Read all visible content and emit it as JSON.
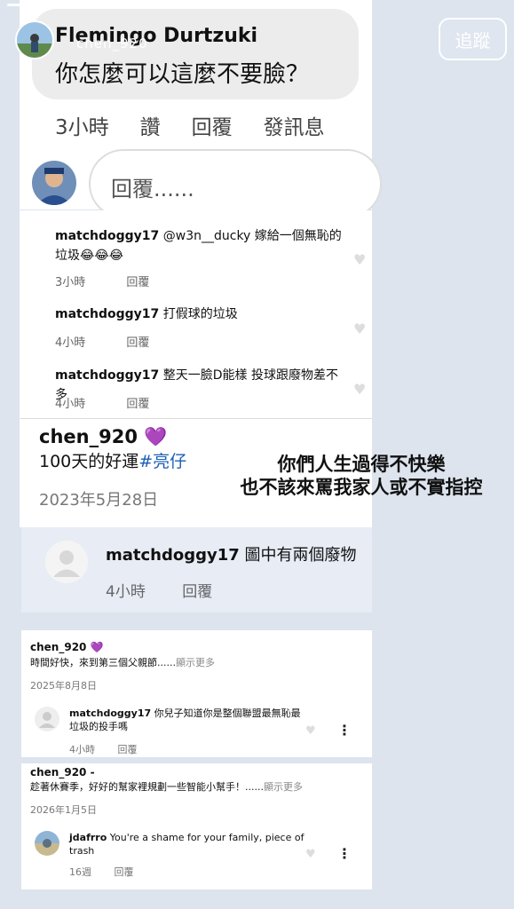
{
  "story": {
    "username": "chen_920",
    "follow_label": "追蹤",
    "overlay_lines": [
      "你們人生過得不快樂",
      "也不該來罵我家人或不實指控"
    ]
  },
  "panel1": {
    "commenter": "Flemingo Durtzuki",
    "comment": "你怎麼可以這麼不要臉？",
    "actions": [
      "3小時",
      "讚",
      "回覆",
      "發訊息"
    ],
    "reply_placeholder": "回覆......"
  },
  "panel2": {
    "comments": [
      {
        "user": "matchdoggy17",
        "text": "@w3n__ducky 嫁給一個無恥的垃圾😂😂😂",
        "time": "3小時",
        "reply": "回覆"
      },
      {
        "user": "matchdoggy17",
        "text": "打假球的垃圾",
        "time": "4小時",
        "reply": "回覆"
      },
      {
        "user": "matchdoggy17",
        "text": "整天一臉D能樣 投球跟廢物差不多",
        "time": "4小時",
        "reply": "回覆"
      }
    ]
  },
  "panel3": {
    "user": "chen_920 💜",
    "caption_text": "100天的好運",
    "caption_tag": "#亮仔",
    "date": "2023年5月28日"
  },
  "panel4": {
    "user": "matchdoggy17",
    "text": "圖中有兩個廢物",
    "time": "4小時",
    "reply": "回覆"
  },
  "panel5": {
    "user": "chen_920 💜",
    "caption": "時間好快，來到第三個父親節......",
    "more": "顯示更多",
    "date": "2025年8月8日",
    "reply_user": "matchdoggy17",
    "reply_text": "你兒子知道你是整個聯盟最無恥最垃圾的投手嗎",
    "reply_time": "4小時",
    "reply_label": "回覆"
  },
  "panel6": {
    "user": "chen_920 -",
    "caption": "趁著休賽季，好好的幫家裡規劃一些智能小幫手！......",
    "more": "顯示更多",
    "date": "2026年1月5日",
    "reply_user": "jdafrro",
    "reply_text": "You're a shame for your family, piece of trash",
    "reply_time": "16週",
    "reply_label": "回覆"
  }
}
